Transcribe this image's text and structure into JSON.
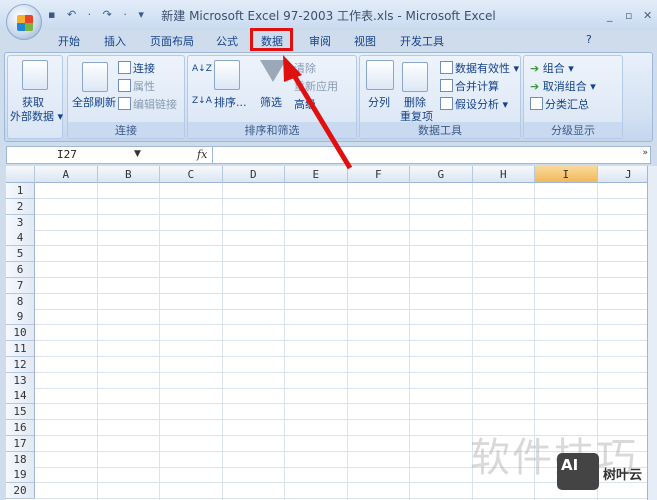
{
  "window": {
    "title": "新建 Microsoft Excel 97-2003 工作表.xls - Microsoft Excel",
    "qat": "▪ ↶ · ↷ · ▾"
  },
  "tabs": [
    "开始",
    "插入",
    "页面布局",
    "公式",
    "数据",
    "审阅",
    "视图",
    "开发工具"
  ],
  "active_tab": "数据",
  "ribbon": {
    "get_external": {
      "label1": "获取",
      "label2": "外部数据 ▾"
    },
    "connections": {
      "label": "连接",
      "refresh_all": "全部刷新",
      "connections": "连接",
      "properties": "属性",
      "edit_links": "编辑链接"
    },
    "sort_filter": {
      "label": "排序和筛选",
      "sort_az": "A↓Z",
      "sort_za": "Z↓A",
      "sort": "排序...",
      "filter": "筛选",
      "clear": "清除",
      "reapply": "重新应用",
      "advanced": "高级"
    },
    "data_tools": {
      "label": "数据工具",
      "text_to_columns": "分列",
      "remove_dup1": "删除",
      "remove_dup2": "重复项",
      "validation": "数据有效性 ▾",
      "consolidate": "合并计算",
      "what_if": "假设分析 ▾"
    },
    "outline": {
      "label": "分级显示",
      "group": "组合 ▾",
      "ungroup": "取消组合 ▾",
      "subtotal": "分类汇总"
    }
  },
  "formula_bar": {
    "name_box": "I27",
    "fx": "fx",
    "value": ""
  },
  "sheet": {
    "columns": [
      "A",
      "B",
      "C",
      "D",
      "E",
      "F",
      "G",
      "H",
      "I",
      "J"
    ],
    "selected_column": "I",
    "rows": [
      "1",
      "2",
      "3",
      "4",
      "5",
      "6",
      "7",
      "8",
      "9",
      "10",
      "11",
      "12",
      "13",
      "14",
      "15",
      "16",
      "17",
      "18",
      "19",
      "20"
    ]
  },
  "watermark": {
    "text": "软件技巧",
    "logo": "AI",
    "brand": "树叶云"
  },
  "colors": {
    "highlight": "#e01010",
    "selected_header": "#f3b85a"
  }
}
